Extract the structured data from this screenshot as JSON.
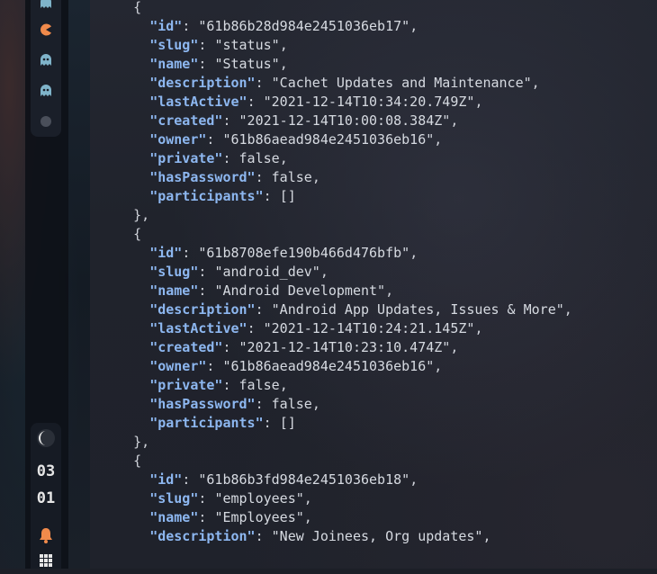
{
  "sidebar": {
    "workspace_icons": [
      "ghost-icon",
      "pacman-icon",
      "ghost-icon",
      "ghost-icon",
      "dot-icon"
    ],
    "clock": {
      "hour": "03",
      "minute": "01"
    },
    "bottom_icons": [
      "moon-icon",
      "bell-icon",
      "grid-icon"
    ],
    "colors": {
      "pacman": "#f08a4b",
      "ghost": "#7fb3c9",
      "bell": "#f08a4b"
    }
  },
  "editor": {
    "lines": [
      {
        "indent": "    ",
        "text": "{"
      },
      {
        "indent": "      ",
        "key": "\"id\"",
        "sep": ": ",
        "value": "\"61b86b28d984e2451036eb17\"",
        "trail": ","
      },
      {
        "indent": "      ",
        "key": "\"slug\"",
        "sep": ": ",
        "value": "\"status\"",
        "trail": ","
      },
      {
        "indent": "      ",
        "key": "\"name\"",
        "sep": ": ",
        "value": "\"Status\"",
        "trail": ","
      },
      {
        "indent": "      ",
        "key": "\"description\"",
        "sep": ": ",
        "value": "\"Cachet Updates and Maintenance\"",
        "trail": ","
      },
      {
        "indent": "      ",
        "key": "\"lastActive\"",
        "sep": ": ",
        "value": "\"2021-12-14T10:34:20.749Z\"",
        "trail": ","
      },
      {
        "indent": "      ",
        "key": "\"created\"",
        "sep": ": ",
        "value": "\"2021-12-14T10:00:08.384Z\"",
        "trail": ","
      },
      {
        "indent": "      ",
        "key": "\"owner\"",
        "sep": ": ",
        "value": "\"61b86aead984e2451036eb16\"",
        "trail": ","
      },
      {
        "indent": "      ",
        "key": "\"private\"",
        "sep": ": ",
        "value": "false",
        "trail": ","
      },
      {
        "indent": "      ",
        "key": "\"hasPassword\"",
        "sep": ": ",
        "value": "false",
        "trail": ","
      },
      {
        "indent": "      ",
        "key": "\"participants\"",
        "sep": ": ",
        "value": "[]",
        "trail": ""
      },
      {
        "indent": "    ",
        "text": "},"
      },
      {
        "indent": "    ",
        "text": "{"
      },
      {
        "indent": "      ",
        "key": "\"id\"",
        "sep": ": ",
        "value": "\"61b8708efe190b466d476bfb\"",
        "trail": ","
      },
      {
        "indent": "      ",
        "key": "\"slug\"",
        "sep": ": ",
        "value": "\"android_dev\"",
        "trail": ","
      },
      {
        "indent": "      ",
        "key": "\"name\"",
        "sep": ": ",
        "value": "\"Android Development\"",
        "trail": ","
      },
      {
        "indent": "      ",
        "key": "\"description\"",
        "sep": ": ",
        "value": "\"Android App Updates, Issues & More\"",
        "trail": ","
      },
      {
        "indent": "      ",
        "key": "\"lastActive\"",
        "sep": ": ",
        "value": "\"2021-12-14T10:24:21.145Z\"",
        "trail": ","
      },
      {
        "indent": "      ",
        "key": "\"created\"",
        "sep": ": ",
        "value": "\"2021-12-14T10:23:10.474Z\"",
        "trail": ","
      },
      {
        "indent": "      ",
        "key": "\"owner\"",
        "sep": ": ",
        "value": "\"61b86aead984e2451036eb16\"",
        "trail": ","
      },
      {
        "indent": "      ",
        "key": "\"private\"",
        "sep": ": ",
        "value": "false",
        "trail": ","
      },
      {
        "indent": "      ",
        "key": "\"hasPassword\"",
        "sep": ": ",
        "value": "false",
        "trail": ","
      },
      {
        "indent": "      ",
        "key": "\"participants\"",
        "sep": ": ",
        "value": "[]",
        "trail": ""
      },
      {
        "indent": "    ",
        "text": "},"
      },
      {
        "indent": "    ",
        "text": "{"
      },
      {
        "indent": "      ",
        "key": "\"id\"",
        "sep": ": ",
        "value": "\"61b86b3fd984e2451036eb18\"",
        "trail": ","
      },
      {
        "indent": "      ",
        "key": "\"slug\"",
        "sep": ": ",
        "value": "\"employees\"",
        "trail": ","
      },
      {
        "indent": "      ",
        "key": "\"name\"",
        "sep": ": ",
        "value": "\"Employees\"",
        "trail": ","
      },
      {
        "indent": "      ",
        "key": "\"description\"",
        "sep": ": ",
        "value": "\"New Joinees, Org updates\"",
        "trail": ","
      }
    ]
  }
}
